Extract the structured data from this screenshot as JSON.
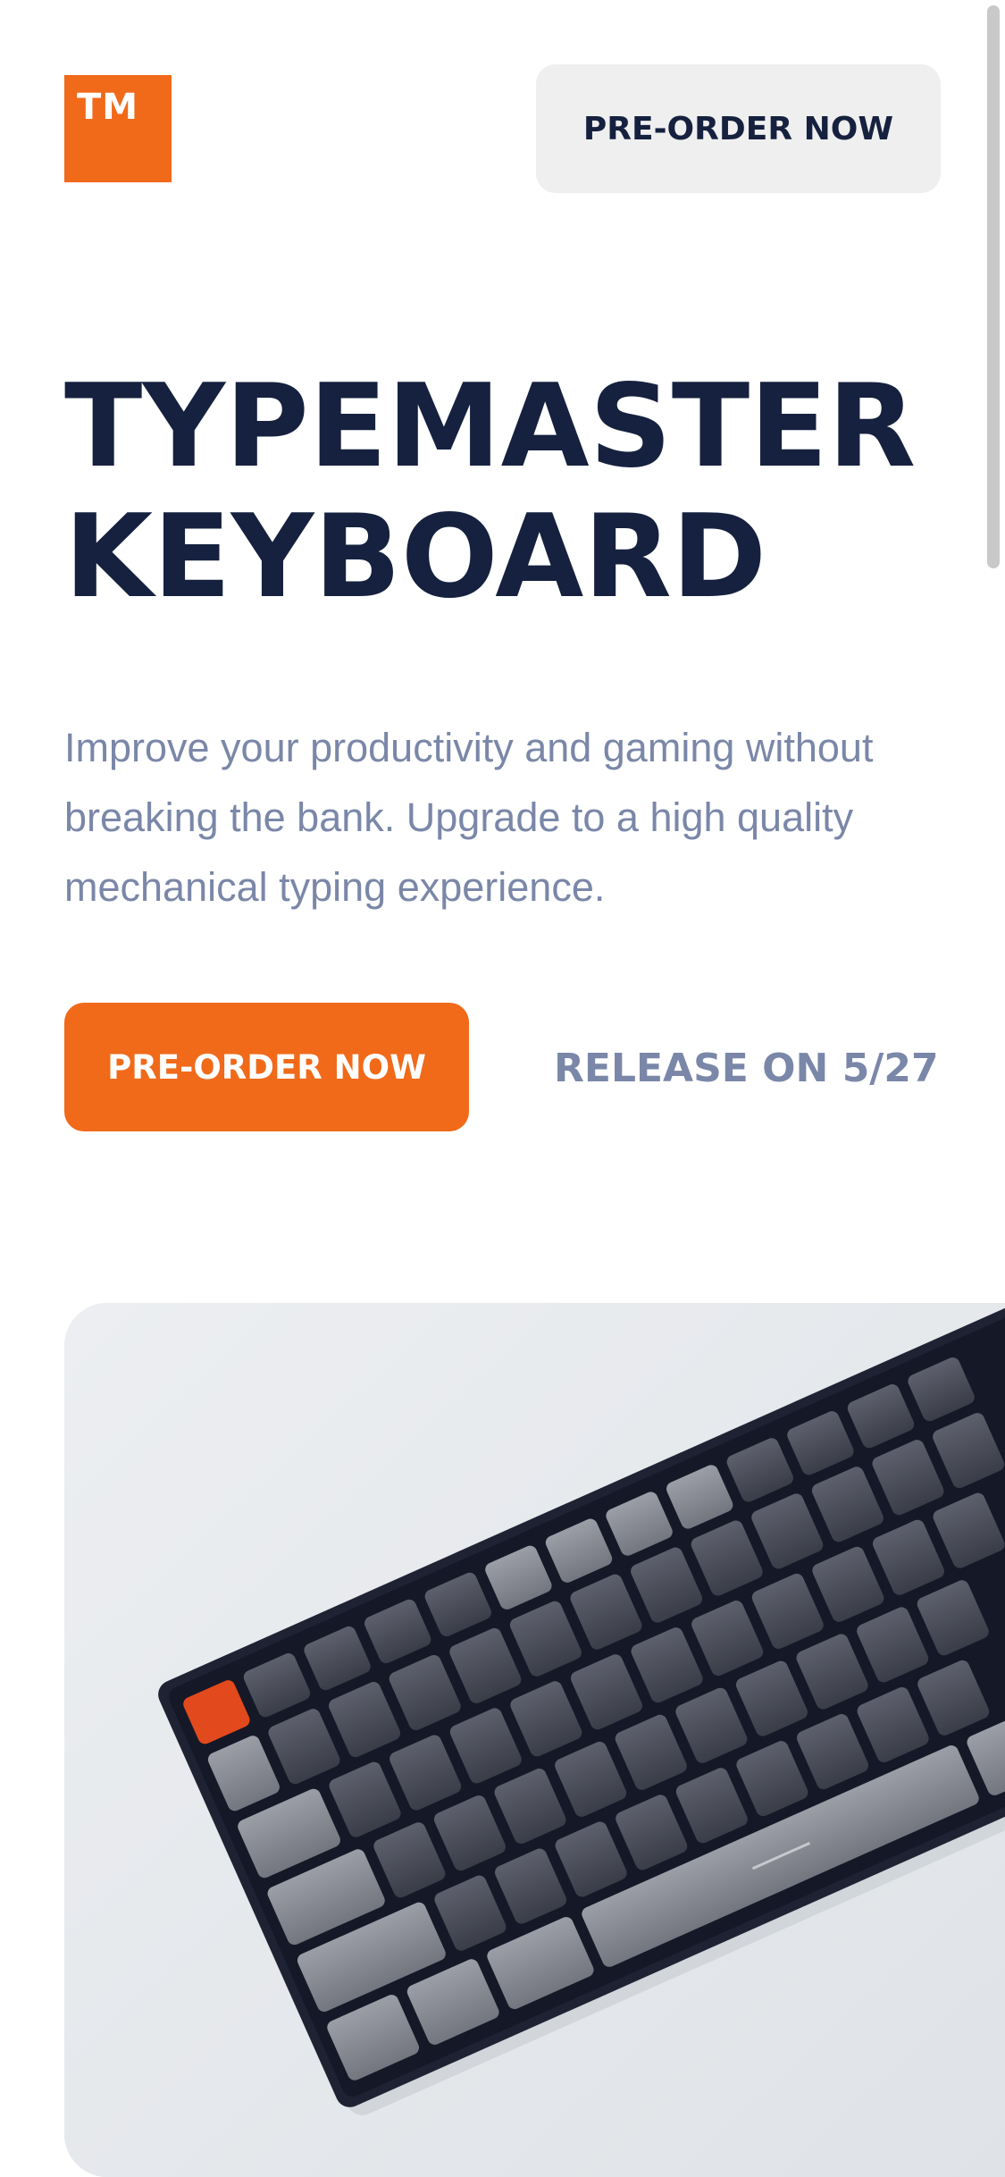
{
  "header": {
    "logo_text": "TM",
    "preorder_label": "PRE-ORDER NOW"
  },
  "hero": {
    "title_line1": "TYPEMASTER",
    "title_line2": "KEYBOARD",
    "description": "Improve your productivity and gaming without breaking the bank. Upgrade to a high quality mechanical typing experience.",
    "cta_label": "PRE-ORDER NOW",
    "release_text": "RELEASE ON 5/27"
  },
  "colors": {
    "accent": "#f06a1a",
    "navy": "#15213e",
    "muted": "#7a87a8",
    "header_button_bg": "#efefef"
  },
  "image": {
    "subject": "keyboard-photo"
  }
}
